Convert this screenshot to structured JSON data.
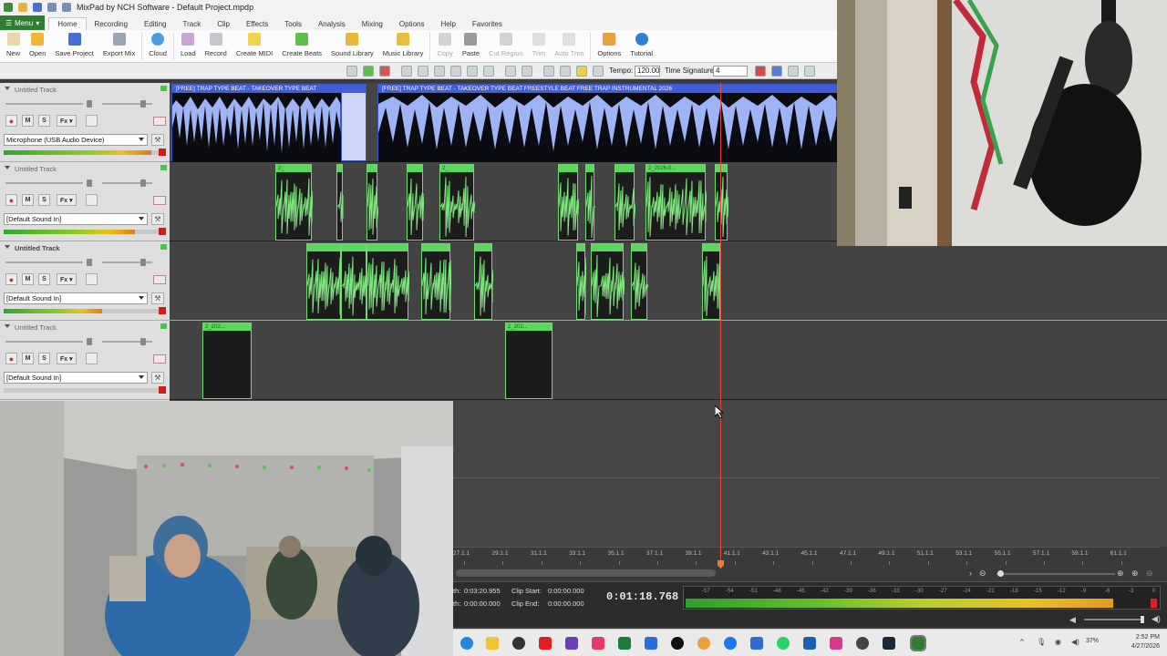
{
  "window": {
    "title": "MixPad by NCH Software - Default Project.mpdp"
  },
  "menubar": {
    "menu_label": "Menu",
    "tabs": [
      "Home",
      "Recording",
      "Editing",
      "Track",
      "Clip",
      "Effects",
      "Tools",
      "Analysis",
      "Mixing",
      "Options",
      "Help",
      "Favorites"
    ]
  },
  "ribbon": {
    "new": "New",
    "open": "Open",
    "save_project": "Save Project",
    "export_mix": "Export Mix",
    "cloud": "Cloud",
    "load": "Load",
    "record": "Record",
    "create_midi": "Create MIDI",
    "create_beats": "Create Beats",
    "sound_library": "Sound Library",
    "music_library": "Music Library",
    "copy": "Copy",
    "paste": "Paste",
    "cut_region": "Cut Region",
    "trim": "Trim",
    "auto_trim": "Auto Trim",
    "options": "Options",
    "tutorial": "Tutorial"
  },
  "subtoolbar": {
    "tempo_label": "Tempo:",
    "tempo_value": "120.00",
    "timesig_label": "Time Signature:",
    "timesig_value": "4"
  },
  "tracks": [
    {
      "name": "Untitled Track",
      "device": "Microphone (USB Audio Device)",
      "level": 0.93,
      "bold": false
    },
    {
      "name": "Untitled Track",
      "device": "[Default Sound In]",
      "level": 0.83,
      "bold": false
    },
    {
      "name": "Untitled Track",
      "device": "[Default Sound In]",
      "level": 0.62,
      "bold": true
    },
    {
      "name": "Untitled Track",
      "device": "[Default Sound In]",
      "level": 0.0,
      "bold": false
    }
  ],
  "track1_clips": {
    "clip_a": "[FREE] TRAP TYPE BEAT - TAKEOVER  TYPE BEAT",
    "clip_b": "[FREE] TRAP TYPE BEAT - TAKEOVER  TYPE BEAT  FREESTYLE BEAT  FREE TRAP INSTRUMENTAL 2026"
  },
  "track2_clips": {
    "label_a": "2_",
    "label_b": "2_2026-0..."
  },
  "track4_clips": {
    "label_a": "2_202...",
    "label_b": "2_202..."
  },
  "ruler": {
    "ticks": [
      "27.1.1",
      "29.1.1",
      "31.1.1",
      "33.1.1",
      "35.1.1",
      "37.1.1",
      "39.1.1",
      "41.1.1",
      "43.1.1",
      "45.1.1",
      "47.1.1",
      "49.1.1",
      "51.1.1",
      "53.1.1",
      "55.1.1",
      "57.1.1",
      "59.1.1",
      "61.1.1"
    ]
  },
  "status": {
    "length_label": "th:",
    "length_value": "0:03:20.955",
    "selection_label": "th:",
    "selection_value": "0:00:00.000",
    "clip_start_label": "Clip Start:",
    "clip_start_value": "0:00:00.000",
    "clip_end_label": "Clip End:",
    "clip_end_value": "0:00:00.000",
    "current_time": "0:01:18.768"
  },
  "level_meter": {
    "labels": [
      "-57",
      "-54",
      "-51",
      "-48",
      "-45",
      "-42",
      "-39",
      "-36",
      "-33",
      "-30",
      "-27",
      "-24",
      "-21",
      "-18",
      "-15",
      "-12",
      "-9",
      "-6",
      "-3",
      "0"
    ],
    "level": 0.92
  },
  "taskbar": {
    "battery": "37%",
    "time": "2:52 PM",
    "date": "4/27/2026"
  },
  "colors": {
    "clip_green": "#5bd85b",
    "beat_blue": "#9fb4f5",
    "playhead": "#e04b3a",
    "menu_green": "#2e7d32"
  }
}
